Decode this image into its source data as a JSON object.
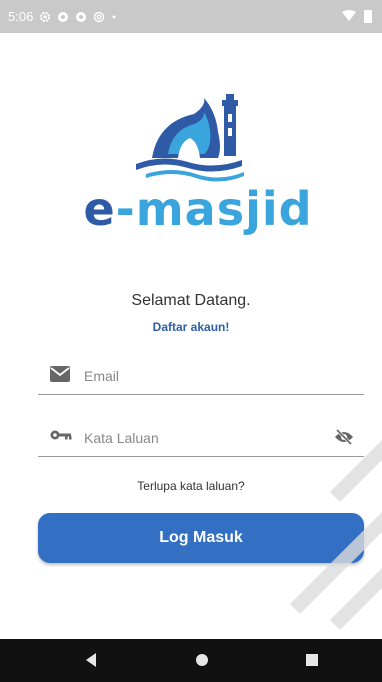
{
  "status_bar": {
    "time": "5:06",
    "icons": [
      "gear-icon",
      "shield-icon",
      "shield-icon",
      "at-icon",
      "dot-icon"
    ],
    "right_icons": [
      "wifi-icon",
      "battery-icon"
    ]
  },
  "logo": {
    "text_e": "e",
    "text_rest": "-masjid",
    "brand_dark": "#2f5aa6",
    "brand_light": "#3aa4dc"
  },
  "welcome": {
    "title": "Selamat Datang.",
    "signup_link": "Daftar akaun!"
  },
  "form": {
    "email": {
      "placeholder": "Email",
      "value": "",
      "icon": "envelope-icon"
    },
    "password": {
      "placeholder": "Kata Laluan",
      "value": "",
      "icon": "key-icon",
      "toggle_icon": "eye-off-icon"
    },
    "forgot_link": "Terlupa kata laluan?",
    "submit_label": "Log Masuk"
  },
  "colors": {
    "primary_button": "#3370c4",
    "link": "#2c5fa8",
    "nav_bar": "#111111"
  },
  "nav_bar": {
    "buttons": [
      "back-icon",
      "home-icon",
      "recent-apps-icon"
    ]
  }
}
